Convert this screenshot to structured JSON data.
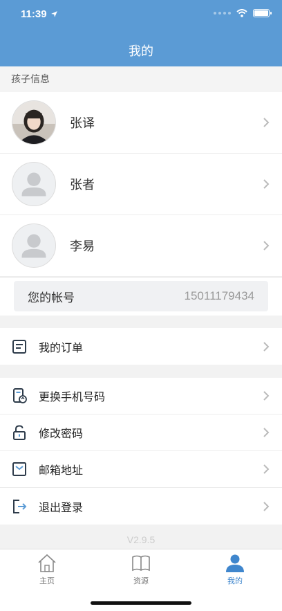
{
  "status_bar": {
    "time": "11:39"
  },
  "header": {
    "title": "我的"
  },
  "children_section": {
    "label": "孩子信息",
    "children": [
      {
        "name": "张译",
        "avatar": "photo"
      },
      {
        "name": "张者",
        "avatar": "default-person-icon"
      },
      {
        "name": "李易",
        "avatar": "default-person-icon"
      }
    ]
  },
  "account": {
    "label": "您的帐号",
    "value": "15011179434"
  },
  "menu": {
    "orders": "我的订单",
    "change_phone": "更换手机号码",
    "change_password": "修改密码",
    "email": "邮箱地址",
    "logout": "退出登录"
  },
  "version": "V2.9.5",
  "tabbar": {
    "home": "主页",
    "resources": "资源",
    "mine": "我的",
    "active_color": "#3f86cd"
  },
  "colors": {
    "header_bg": "#5b9bd5",
    "page_bg": "#f2f2f2"
  }
}
